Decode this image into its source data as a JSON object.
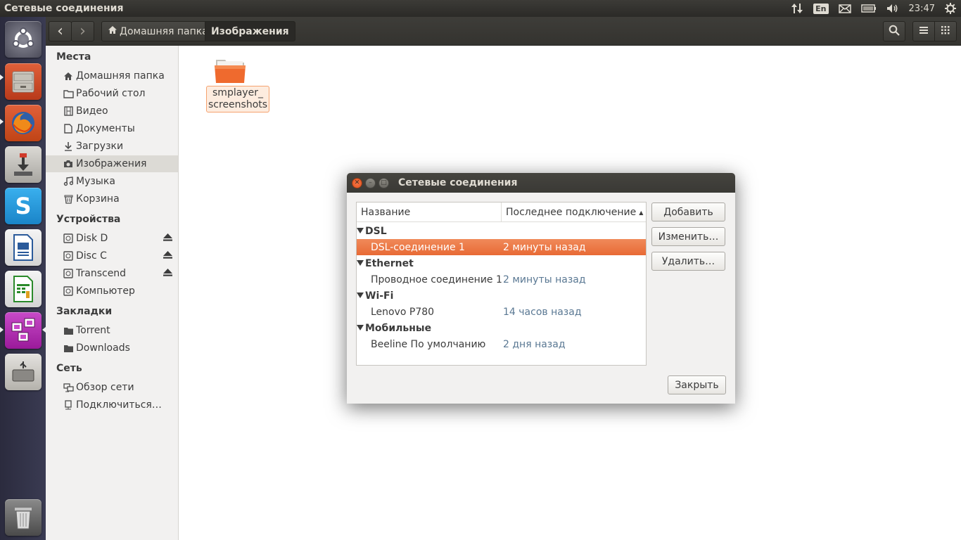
{
  "top_panel": {
    "title": "Сетевые соединения",
    "keyboard_layout": "En",
    "time": "23:47"
  },
  "launcher": {
    "items": [
      {
        "name": "ubuntu-dash",
        "icon": "ubuntu-logo-icon"
      },
      {
        "name": "files",
        "icon": "file-cabinet-icon"
      },
      {
        "name": "firefox",
        "icon": "firefox-icon"
      },
      {
        "name": "software-center",
        "icon": "download-icon"
      },
      {
        "name": "skype",
        "icon": "skype-icon"
      },
      {
        "name": "libreoffice-writer",
        "icon": "document-icon"
      },
      {
        "name": "libreoffice-calc",
        "icon": "spreadsheet-icon"
      },
      {
        "name": "libreoffice-impress",
        "icon": "presentation-icon"
      },
      {
        "name": "usb-creator",
        "icon": "usb-drive-icon"
      },
      {
        "name": "trash",
        "icon": "trash-icon"
      }
    ]
  },
  "toolbar": {
    "back_label": "‹",
    "forward_label": "›",
    "breadcrumbs": [
      "Домашняя папка",
      "Изображения"
    ]
  },
  "sidebar": {
    "places_header": "Места",
    "places": [
      "Домашняя папка",
      "Рабочий стол",
      "Видео",
      "Документы",
      "Загрузки",
      "Изображения",
      "Музыка",
      "Корзина"
    ],
    "devices_header": "Устройства",
    "devices": [
      "Disk D",
      "Disc C",
      "Transcend",
      "Компьютер"
    ],
    "bookmarks_header": "Закладки",
    "bookmarks": [
      "Torrent",
      "Downloads"
    ],
    "network_header": "Сеть",
    "network": [
      "Обзор сети",
      "Подключиться…"
    ]
  },
  "content": {
    "folder_label_line1": "smplayer_",
    "folder_label_line2": "screenshots"
  },
  "dialog": {
    "title": "Сетевые соединения",
    "col_name": "Название",
    "col_last": "Последнее подключение",
    "groups": [
      {
        "name": "DSL",
        "conn": "DSL-соединение 1",
        "last": "2 минуты назад"
      },
      {
        "name": "Ethernet",
        "conn": "Проводное соединение 1",
        "last": "2 минуты назад"
      },
      {
        "name": "Wi-Fi",
        "conn": "Lenovo P780",
        "last": "14 часов назад"
      },
      {
        "name": "Мобильные",
        "conn": "Beeline По умолчанию",
        "last": "2 дня назад"
      }
    ],
    "btn_add": "Добавить",
    "btn_edit": "Изменить…",
    "btn_delete": "Удалить…",
    "btn_close": "Закрыть"
  },
  "colors": {
    "accent": "#e95420",
    "selection": "#f07746",
    "panel": "#3c3b37"
  }
}
